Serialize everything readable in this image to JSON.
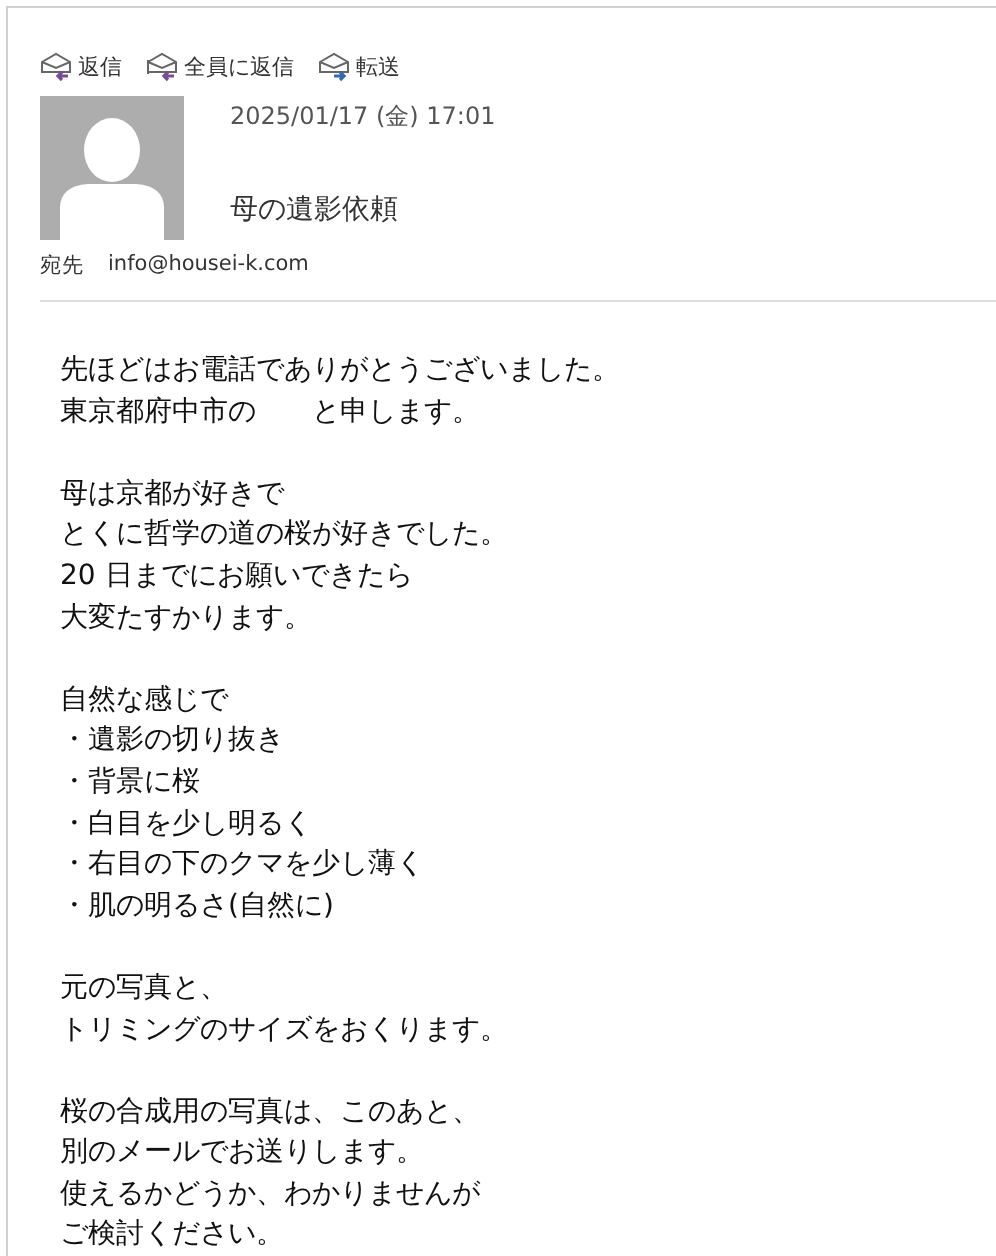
{
  "toolbar": [
    {
      "kind": "reply",
      "label": "返信"
    },
    {
      "kind": "reply_all",
      "label": "全員に返信"
    },
    {
      "kind": "forward",
      "label": "転送"
    }
  ],
  "header": {
    "date": "2025/01/17 (金) 17:01",
    "subject": "母の遺影依頼",
    "to_label": "宛先",
    "to": "info@housei-k.com"
  },
  "body": [
    [
      "先ほどはお電話でありがとうございました。",
      "東京都府中市の　　と申します。"
    ],
    [
      "母は京都が好きで",
      "とくに哲学の道の桜が好きでした。",
      "20 日までにお願いできたら",
      "大変たすかります。"
    ],
    [
      "自然な感じで",
      "・遺影の切り抜き",
      "・背景に桜",
      "・白目を少し明るく",
      "・右目の下のクマを少し薄く",
      "・肌の明るさ(自然に)"
    ],
    [
      "元の写真と、",
      "トリミングのサイズをおくります。"
    ],
    [
      "桜の合成用の写真は、このあと、",
      "別のメールでお送りします。",
      "使えるかどうか、わかりませんが",
      "ご検討ください。"
    ]
  ]
}
